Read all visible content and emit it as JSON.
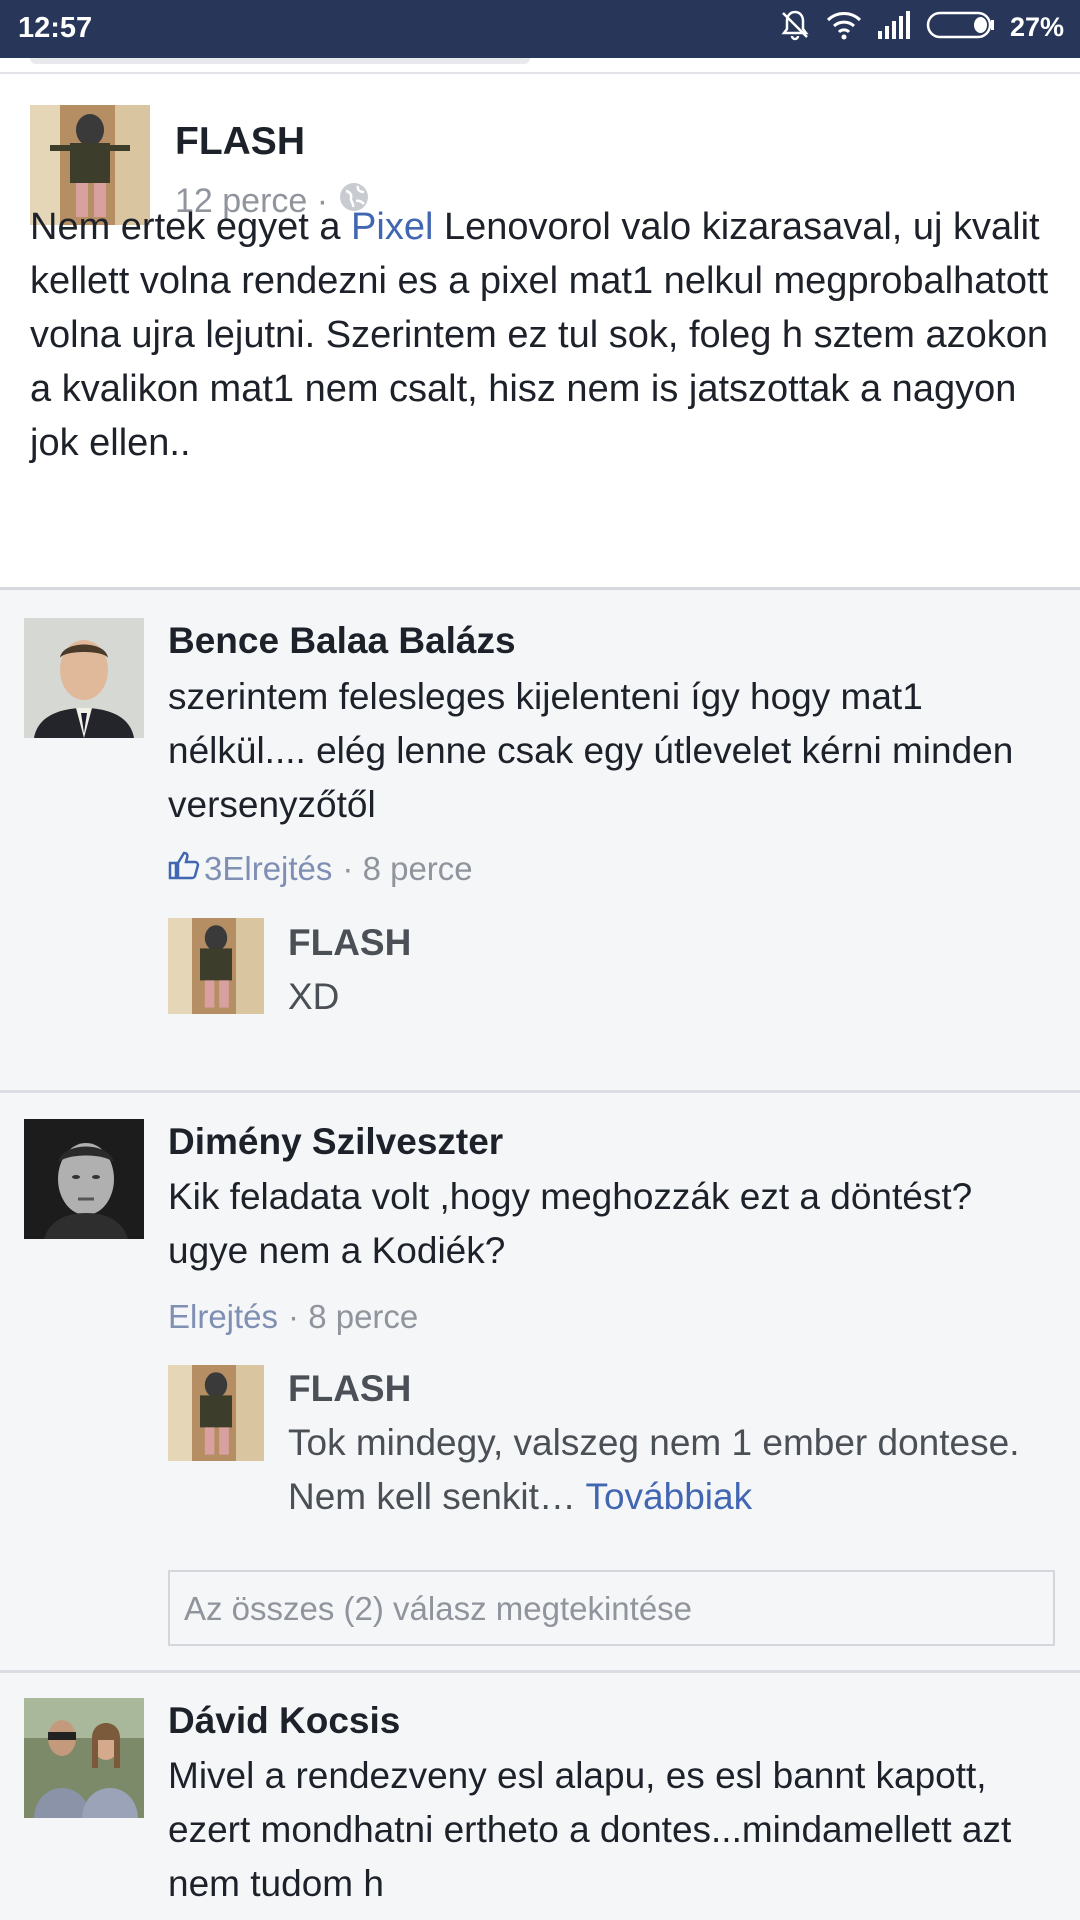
{
  "status": {
    "time": "12:57",
    "battery": "27%"
  },
  "post": {
    "author": "FLASH",
    "time": "12 perce ·",
    "text_before": "Nem ertek egyet a ",
    "text_link": "Pixel",
    "text_after": " Lenovorol valo kizarasaval, uj kvalit kellett volna rendezni es a pixel mat1 nelkul megprobalhatott volna ujra lejutni. Szerintem ez tul sok, foleg h sztem azokon a kvalikon mat1 nem csalt, hisz nem is jatszottak a nagyon jok ellen.."
  },
  "comments": [
    {
      "name": "Bence Balaa Balázs",
      "text": "szerintem felesleges kijelenteni így hogy mat1 nélkül.... elég lenne csak egy útlevelet kérni minden versenyzőtől",
      "likes": "3",
      "hide": "Elrejtés",
      "time": "· 8 perce",
      "reply": {
        "name": "FLASH",
        "text": "XD"
      }
    },
    {
      "name": "Dimény Szilveszter",
      "text": "Kik feladata volt ,hogy meghozzák ezt a döntést? ugye nem a Kodiék?",
      "hide": "Elrejtés",
      "time": "· 8 perce",
      "reply": {
        "name": "FLASH",
        "text": "Tok mindegy, valszeg nem 1 ember dontese. Nem kell senkit… ",
        "more": "Továbbiak"
      },
      "view_all": "Az összes (2) válasz megtekintése"
    },
    {
      "name": "Dávid Kocsis",
      "text": "Mivel a rendezveny esl alapu, es esl bannt kapott, ezert mondhatni ertheto a dontes...mindamellett azt nem tudom h"
    }
  ],
  "icons": {
    "mute": "mute-icon",
    "wifi": "wifi-icon",
    "signal": "signal-icon",
    "battery": "battery-icon",
    "globe": "globe-icon",
    "like": "thumbs-up-icon"
  },
  "colors": {
    "statusbar": "#283759",
    "link": "#4267b2",
    "meta": "#90949c"
  }
}
